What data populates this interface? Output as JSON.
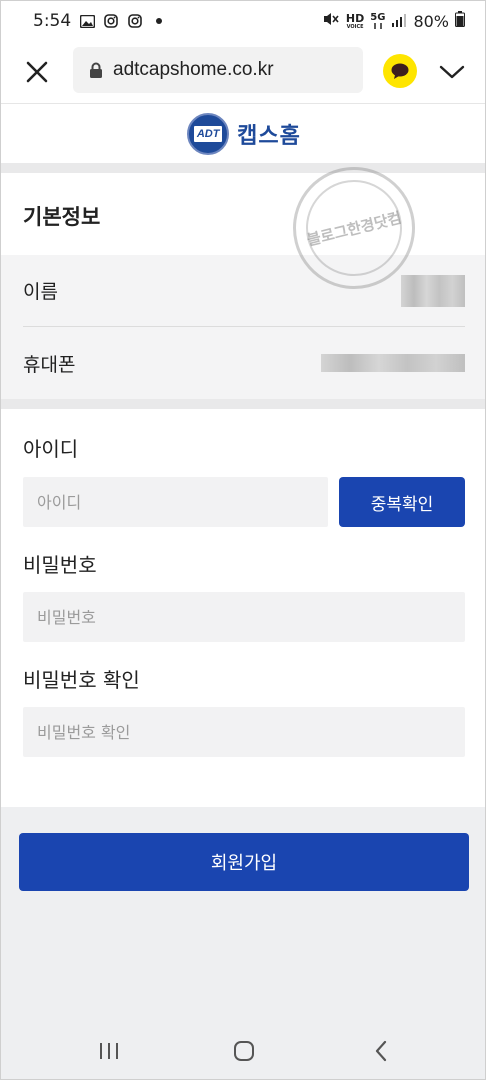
{
  "status_bar": {
    "time": "5:54",
    "battery": "80%",
    "net_hd": "HD",
    "net_5g": "5G",
    "net_voice": "VOICE"
  },
  "browser": {
    "url": "adtcapshome.co.kr"
  },
  "logo": {
    "brand": "캡스홈",
    "badge": "ADT"
  },
  "watermark": {
    "text": "블로그한경닷컴"
  },
  "basic_info": {
    "title": "기본정보",
    "rows": [
      {
        "label": "이름"
      },
      {
        "label": "휴대폰"
      }
    ]
  },
  "form": {
    "id_label": "아이디",
    "id_placeholder": "아이디",
    "dup_check_label": "중복확인",
    "password_label": "비밀번호",
    "password_placeholder": "비밀번호",
    "password_confirm_label": "비밀번호 확인",
    "password_confirm_placeholder": "비밀번호 확인"
  },
  "actions": {
    "signup_label": "회원가입"
  },
  "colors": {
    "primary": "#1a45b0",
    "brand": "#1e4a9a",
    "kakao": "#FEE500"
  }
}
